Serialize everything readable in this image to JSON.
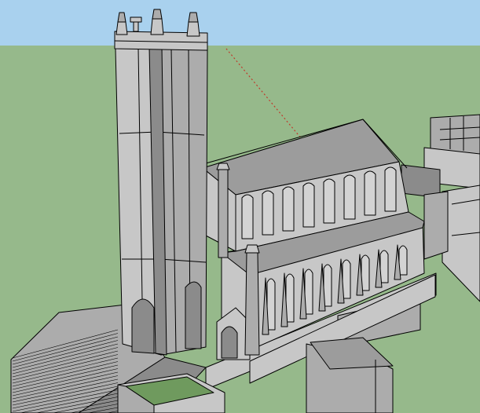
{
  "viewport": {
    "colors": {
      "sky": "#a9d1ee",
      "ground": "#96b98b",
      "wall_light": "#c7c7c7",
      "wall_mid": "#acacac",
      "wall_dark": "#8b8b8b",
      "roof": "#9c9c9c",
      "window": "#d3d3d3",
      "edge": "#000000",
      "green_roof": "#6f9a5e",
      "axis_red": "#c0392b"
    }
  }
}
